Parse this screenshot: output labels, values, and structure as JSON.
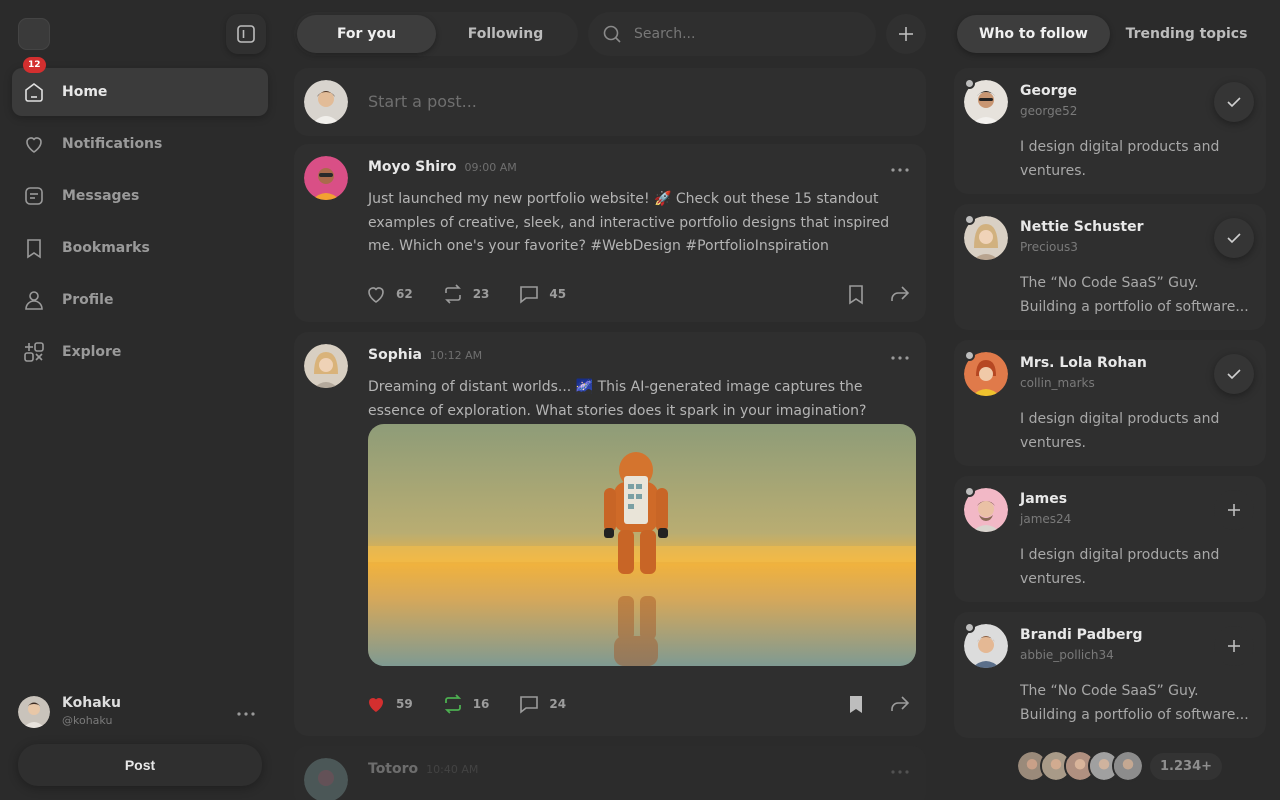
{
  "sidebar": {
    "nav": [
      {
        "label": "Home",
        "icon": "home-icon",
        "active": true
      },
      {
        "label": "Notifications",
        "icon": "heart-icon"
      },
      {
        "label": "Messages",
        "icon": "message-icon"
      },
      {
        "label": "Bookmarks",
        "icon": "bookmark-icon"
      },
      {
        "label": "Profile",
        "icon": "user-icon"
      },
      {
        "label": "Explore",
        "icon": "explore-icon"
      }
    ],
    "notification_count": "12",
    "user": {
      "name": "Kohaku",
      "handle": "@kohaku"
    },
    "post_label": "Post"
  },
  "topbar": {
    "tabs": [
      "For you",
      "Following"
    ],
    "search_placeholder": "Search..."
  },
  "composer": {
    "placeholder": "Start a post..."
  },
  "posts": [
    {
      "author": "Moyo Shiro",
      "time": "09:00 AM",
      "text": "Just launched my new portfolio website! 🚀 Check out these 15 standout examples of creative, sleek, and interactive portfolio designs that inspired me. Which one's your favorite? #WebDesign #PortfolioInspiration",
      "likes": "62",
      "reposts": "23",
      "comments": "45"
    },
    {
      "author": "Sophia",
      "time": "10:12 AM",
      "text": "Dreaming of distant worlds... 🌌 This AI-generated image captures the essence of exploration. What stories does it spark in your imagination?",
      "likes": "59",
      "reposts": "16",
      "comments": "24"
    },
    {
      "author": "Totoro",
      "time": "10:40 AM"
    }
  ],
  "right": {
    "tabs": [
      "Who to follow",
      "Trending topics"
    ],
    "people": [
      {
        "name": "George",
        "handle": "george52",
        "bio": "I design digital products and ventures.",
        "following": true
      },
      {
        "name": "Nettie Schuster",
        "handle": "Precious3",
        "bio": "The “No Code SaaS” Guy. Building a portfolio of software...",
        "following": true
      },
      {
        "name": "Mrs. Lola Rohan",
        "handle": "collin_marks",
        "bio": "I design digital products and ventures.",
        "following": true
      },
      {
        "name": "James",
        "handle": "james24",
        "bio": "I design digital products and ventures.",
        "following": false
      },
      {
        "name": "Brandi Padberg",
        "handle": "abbie_pollich34",
        "bio": "The “No Code SaaS” Guy. Building a portfolio of software...",
        "following": false
      }
    ],
    "more_count": "1.234+"
  },
  "colors": {
    "like_active": "#d32f2f",
    "repost_active": "#4caf50",
    "badge": "#d32f2f"
  }
}
